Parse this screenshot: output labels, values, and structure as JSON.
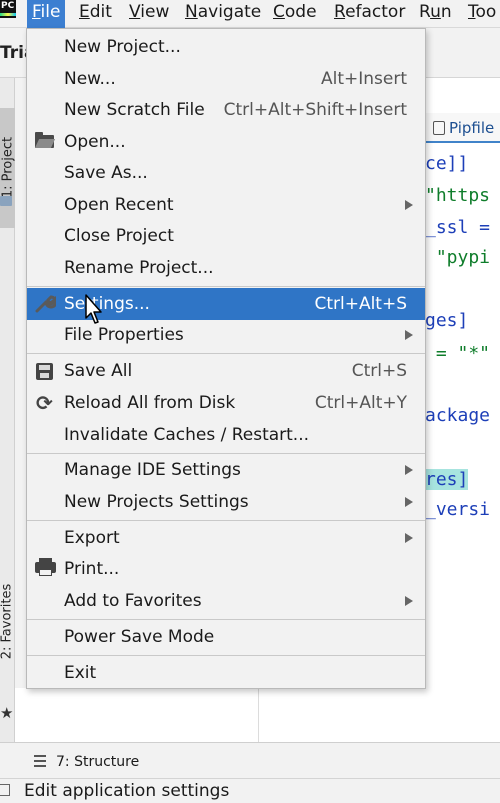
{
  "menubar": {
    "logo": "PC",
    "items": [
      {
        "label": "File",
        "mnemonic": "F",
        "rest": "ile",
        "active": true
      },
      {
        "label": "Edit",
        "mnemonic": "E",
        "rest": "dit"
      },
      {
        "label": "View",
        "mnemonic": "V",
        "rest": "iew"
      },
      {
        "label": "Navigate",
        "mnemonic": "N",
        "rest": "avigate"
      },
      {
        "label": "Code",
        "mnemonic": "C",
        "rest": "ode"
      },
      {
        "label": "Refactor",
        "mnemonic": "R",
        "rest": "efactor"
      },
      {
        "label": "Run",
        "mnemonic": "u",
        "prefix": "R",
        "rest": "n"
      },
      {
        "label": "Too",
        "mnemonic": "T",
        "rest": "oo"
      }
    ]
  },
  "project_name": "Tria",
  "left_stripe": {
    "project_tab": "1: Project",
    "favorites_tab": "2: Favorites"
  },
  "editor": {
    "tab_label": "Pipfile",
    "lines": [
      {
        "text": "ce]]",
        "kind": "bracket"
      },
      {
        "text": "\"https",
        "kind": "string"
      },
      {
        "text": "_ssl =",
        "kind": "plain"
      },
      {
        "text": " \"pypi",
        "kind": "string"
      },
      {
        "text": "",
        "kind": "plain"
      },
      {
        "text": "ges]",
        "kind": "bracket"
      },
      {
        "text": " = \"*\"",
        "kind": "string"
      },
      {
        "text": "",
        "kind": "plain"
      },
      {
        "text": "ackage",
        "kind": "bracket"
      },
      {
        "text": "",
        "kind": "plain"
      },
      {
        "text": "res]",
        "kind": "bracket"
      },
      {
        "text": "_versi",
        "kind": "bracket"
      }
    ]
  },
  "dropdown": {
    "items": [
      {
        "label": "New Project...",
        "shortcut": ""
      },
      {
        "label": "New...",
        "shortcut": "Alt+Insert"
      },
      {
        "label": "New Scratch File",
        "shortcut": "Ctrl+Alt+Shift+Insert"
      },
      {
        "label": "Open...",
        "shortcut": "",
        "icon": "folder-icon"
      },
      {
        "label": "Save As...",
        "shortcut": ""
      },
      {
        "label": "Open Recent",
        "shortcut": "",
        "submenu": true
      },
      {
        "label": "Close Project",
        "shortcut": ""
      },
      {
        "label": "Rename Project...",
        "shortcut": ""
      },
      {
        "label": "Settings...",
        "shortcut": "Ctrl+Alt+S",
        "icon": "wrench-icon",
        "highlighted": true
      },
      {
        "label": "File Properties",
        "shortcut": "",
        "submenu": true
      },
      {
        "label": "Save All",
        "shortcut": "Ctrl+S",
        "icon": "save-icon"
      },
      {
        "label": "Reload All from Disk",
        "shortcut": "Ctrl+Alt+Y",
        "icon": "reload-icon"
      },
      {
        "label": "Invalidate Caches / Restart...",
        "shortcut": ""
      },
      {
        "label": "Manage IDE Settings",
        "shortcut": "",
        "submenu": true
      },
      {
        "label": "New Projects Settings",
        "shortcut": "",
        "submenu": true
      },
      {
        "label": "Export",
        "shortcut": "",
        "submenu": true
      },
      {
        "label": "Print...",
        "shortcut": "",
        "icon": "print-icon"
      },
      {
        "label": "Add to Favorites",
        "shortcut": "",
        "submenu": true
      },
      {
        "label": "Power Save Mode",
        "shortcut": ""
      },
      {
        "label": "Exit",
        "shortcut": ""
      }
    ]
  },
  "bottom": {
    "structure_tab": "7: Structure"
  },
  "statusbar": {
    "text": "Edit application settings"
  },
  "colors": {
    "highlight": "#2f75c6",
    "menu_active": "#3c7fd1",
    "editor_bg": "#ffffff",
    "chrome_bg": "#f2f2f2"
  }
}
